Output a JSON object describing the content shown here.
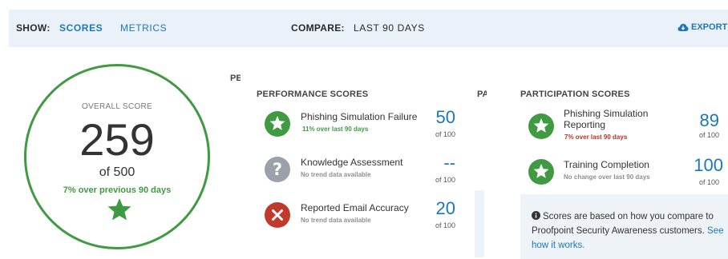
{
  "toolbar": {
    "show_label": "SHOW:",
    "tabs": [
      {
        "label": "SCORES",
        "active": true
      },
      {
        "label": "METRICS",
        "active": false
      }
    ],
    "compare_label": "COMPARE:",
    "compare_value": "LAST 90 DAYS",
    "export_label": "EXPORT",
    "export_icon": "cloud-download-icon"
  },
  "overall": {
    "label": "OVERALL SCORE",
    "score": "259",
    "out_of": "of 500",
    "trend": "7% over previous 90 days",
    "icon": "star-icon"
  },
  "performance": {
    "title": "PERFORMANCE SCORES",
    "items": [
      {
        "name": "Phishing Simulation Failure",
        "trend": "11% over last 90 days",
        "trend_type": "up",
        "value": "50",
        "out_of": "of 100",
        "icon": "star-check-icon"
      },
      {
        "name": "Knowledge Assessment",
        "trend": "No trend data available",
        "trend_type": "none",
        "value": "--",
        "out_of": "of 100",
        "icon": "question-icon"
      },
      {
        "name": "Reported Email Accuracy",
        "trend": "No trend data available",
        "trend_type": "none",
        "value": "20",
        "out_of": "of 100",
        "icon": "x-circle-icon"
      }
    ]
  },
  "participation": {
    "title": "PARTICIPATION SCORES",
    "items": [
      {
        "name": "Phishing Simulation Reporting",
        "trend": "7% over last 90 days",
        "trend_type": "down",
        "value": "89",
        "out_of": "of 100",
        "icon": "star-check-icon"
      },
      {
        "name": "Training Completion",
        "trend": "No change over last 90 days",
        "trend_type": "none",
        "value": "100",
        "out_of": "of 100",
        "icon": "star-check-icon"
      }
    ]
  },
  "info": {
    "text": "Scores are based on how you compare to Proofpoint Security Awareness customers.",
    "link": "See how it works."
  },
  "ghosts": {
    "left": "PE",
    "right": "PA"
  },
  "colors": {
    "accent_blue": "#1b78b8",
    "good_green": "#3f9a42",
    "bad_red": "#b5342b",
    "neutral_gray": "#8f8f8f",
    "topbar_bg": "#eaf1f9"
  }
}
